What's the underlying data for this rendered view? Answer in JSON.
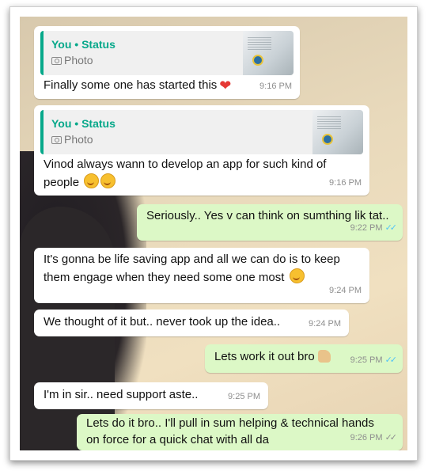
{
  "messages": [
    {
      "quote_title": "You • Status",
      "quote_sub": "Photo",
      "text": "Finally some one has started this",
      "time": "9:16 PM"
    },
    {
      "quote_title": "You • Status",
      "quote_sub": "Photo",
      "text_line1": "Vinod always wann to develop an app for such kind of",
      "text_line2": "people",
      "time": "9:16 PM"
    },
    {
      "text": "Seriously.. Yes v can think on sumthing lik tat..",
      "time": "9:22 PM",
      "ticks": "✓✓"
    },
    {
      "text_line1": "It's gonna be life saving app and all we can do is to keep",
      "text_line2": "them engage when they need some one most",
      "time": "9:24 PM"
    },
    {
      "text": "We thought of it but.. never took up the idea..",
      "time": "9:24 PM"
    },
    {
      "text": "Lets work it out bro",
      "time": "9:25 PM",
      "ticks": "✓✓"
    },
    {
      "text": "I'm in sir.. need support aste..",
      "time": "9:25 PM"
    },
    {
      "text_line1": "Lets do it bro.. I'll pull in sum helping & technical hands",
      "text_line2": "on force for a quick chat with all da",
      "time": "9:26 PM",
      "ticks": "✓✓"
    }
  ],
  "icons": {
    "camera": "camera-icon",
    "heart": "heart-emoji",
    "smile": "smiling-emoji",
    "thumbs": "thumbs-up-emoji",
    "ticks": "double-check-icon"
  },
  "colors": {
    "incoming": "#ffffff",
    "outgoing": "#dcf8c6",
    "quote_accent": "#06a88a",
    "read_ticks": "#4fc3f7"
  }
}
